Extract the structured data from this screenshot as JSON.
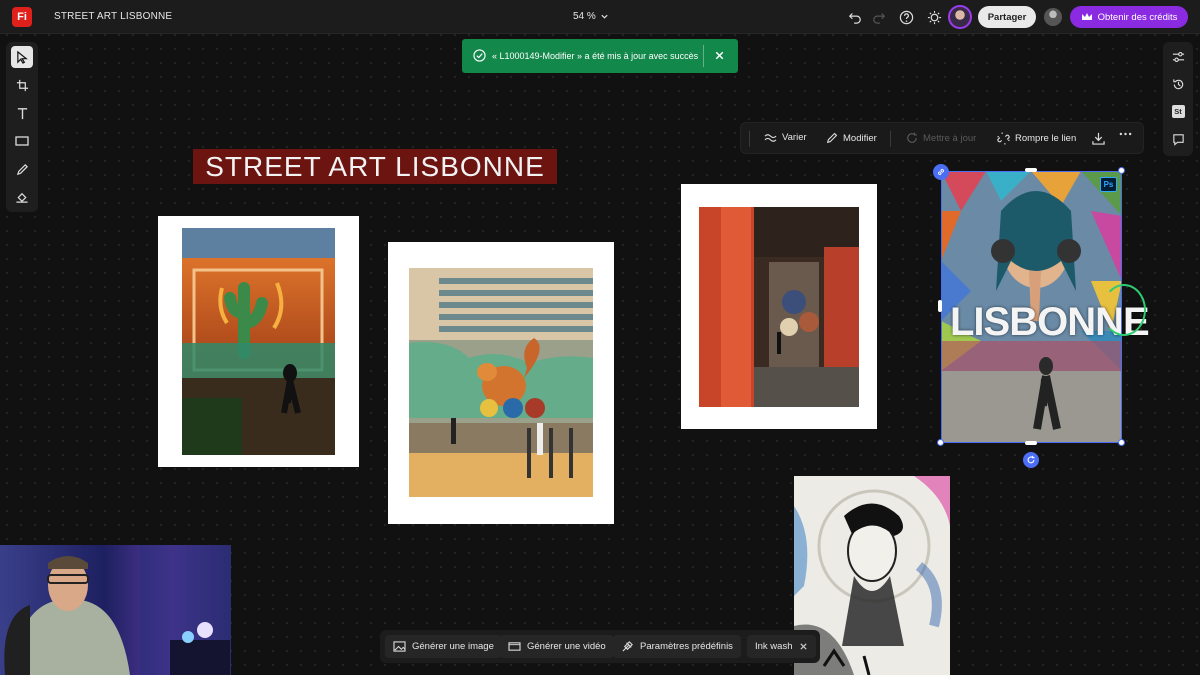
{
  "app": {
    "logo_text": "Fi",
    "document_title": "STREET ART LISBONNE",
    "zoom_level": "54 %"
  },
  "header": {
    "share_label": "Partager",
    "credits_label": "Obtenir des crédits",
    "accent_color": "#8a2be2"
  },
  "toast": {
    "message": "« L1000149-Modifier » a été mis à jour avec succès",
    "color": "#12884a"
  },
  "context_toolbar": {
    "vary_label": "Varier",
    "edit_label": "Modifier",
    "update_label": "Mettre à jour",
    "unlink_label": "Rompre le lien"
  },
  "canvas": {
    "banner_title": "STREET ART LISBONNE",
    "poster_title": "LISBONNE",
    "ps_badge": "Ps"
  },
  "right_rail": {
    "stock_badge": "St"
  },
  "bottom_bar": {
    "generate_image_label": "Générer une image",
    "generate_video_label": "Générer une vidéo",
    "presets_label": "Paramètres prédéfinis",
    "style_chip_label": "Ink wash"
  }
}
